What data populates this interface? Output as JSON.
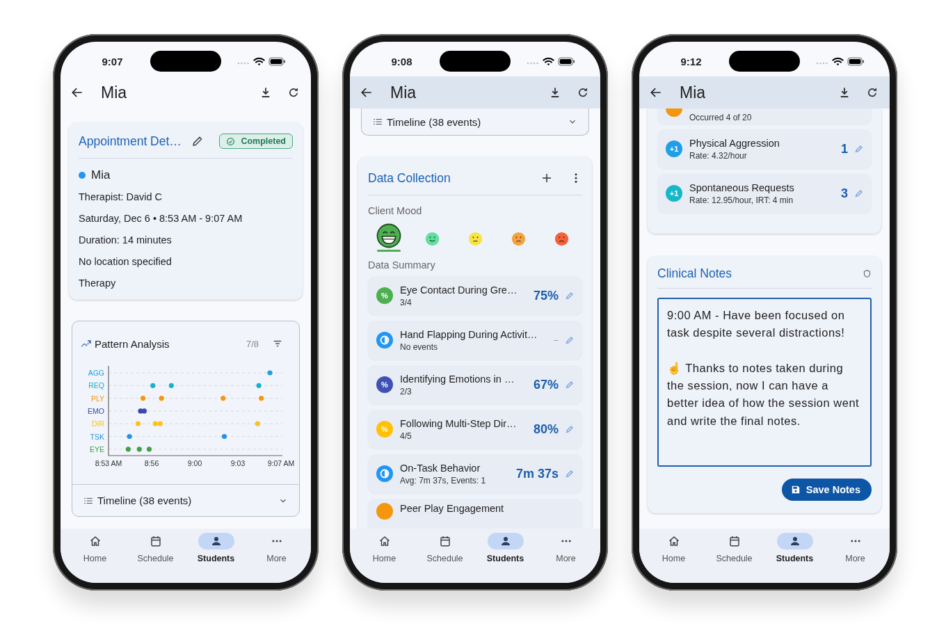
{
  "phones": [
    {
      "kind": "appointment",
      "status_bar": {
        "time": "9:07"
      },
      "app_bar": {
        "title": "Mia",
        "elevated": false
      },
      "appointment": {
        "title": "Appointment Det…",
        "status": "Completed",
        "client": "Mia",
        "details": [
          "Therapist: David C",
          "Saturday, Dec 6 • 8:53 AM - 9:07 AM",
          "Duration: 14 minutes",
          "No location specified",
          "Therapy"
        ]
      },
      "pattern": {
        "title": "Pattern Analysis",
        "count": "7/8",
        "rows": [
          {
            "label": "AGG",
            "color": "#1e9fe0"
          },
          {
            "label": "REQ",
            "color": "#16b3c8"
          },
          {
            "label": "PLY",
            "color": "#f5960f"
          },
          {
            "label": "EMO",
            "color": "#3949ab"
          },
          {
            "label": "DIR",
            "color": "#f9c31f"
          },
          {
            "label": "TSK",
            "color": "#2191ee"
          },
          {
            "label": "EYE",
            "color": "#43a047"
          }
        ],
        "time_labels": [
          "8:53 AM",
          "8:56",
          "9:00",
          "9:03",
          "9:07 AM"
        ]
      },
      "timeline": {
        "label": "Timeline (38 events)",
        "expanded": false
      },
      "nav": [
        {
          "label": "Home",
          "selected": false
        },
        {
          "label": "Schedule",
          "selected": false
        },
        {
          "label": "Students",
          "selected": true
        },
        {
          "label": "More",
          "selected": false
        }
      ]
    },
    {
      "kind": "data",
      "status_bar": {
        "time": "9:08"
      },
      "app_bar": {
        "title": "Mia",
        "elevated": true
      },
      "timeline": {
        "label": "Timeline (38 events)",
        "expanded": false
      },
      "data_collection": {
        "title": "Data Collection",
        "mood_label": "Client Mood",
        "moods": [
          {
            "kind": "grin",
            "color": "#4caf50",
            "selected": true
          },
          {
            "kind": "smile",
            "color": "#5ee0a0",
            "selected": false
          },
          {
            "kind": "neutral",
            "color": "#f7e443",
            "selected": false
          },
          {
            "kind": "uneasy",
            "color": "#f6a23c",
            "selected": false
          },
          {
            "kind": "sad",
            "color": "#f4603a",
            "selected": false
          }
        ],
        "summary_label": "Data Summary",
        "items": [
          {
            "kind": "percent",
            "badge": "%",
            "color": "#4caf50",
            "title": "Eye Contact During Gre…",
            "subtitle": "3/4",
            "value": "75%",
            "muted": false
          },
          {
            "kind": "timer",
            "color": "#2196f3",
            "title": "Hand Flapping During Activit…",
            "subtitle": "No events",
            "value": "–",
            "muted": true
          },
          {
            "kind": "percent",
            "badge": "%",
            "color": "#3f51b5",
            "title": "Identifying Emotions in …",
            "subtitle": "2/3",
            "value": "67%",
            "muted": false
          },
          {
            "kind": "percent",
            "badge": "%",
            "color": "#ffc107",
            "title": "Following Multi-Step Dir…",
            "subtitle": "4/5",
            "value": "80%",
            "muted": false
          },
          {
            "kind": "timer",
            "color": "#2196f3",
            "title": "On-Task Behavior",
            "subtitle": "Avg: 7m 37s, Events: 1",
            "value": "7m 37s",
            "muted": false
          },
          {
            "kind": "clipped",
            "color": "#f5960f",
            "title": "Peer Play Engagement"
          }
        ]
      },
      "nav": [
        {
          "label": "Home",
          "selected": false
        },
        {
          "label": "Schedule",
          "selected": false
        },
        {
          "label": "Students",
          "selected": true
        },
        {
          "label": "More",
          "selected": false
        }
      ]
    },
    {
      "kind": "notes",
      "status_bar": {
        "time": "9:12"
      },
      "app_bar": {
        "title": "Mia",
        "elevated": true
      },
      "behaviors": [
        {
          "kind": "clipped-top",
          "color": "#f5960f",
          "subtitle": "Occurred 4 of 20"
        },
        {
          "kind": "count",
          "badge": "+1",
          "color": "#1e9fe8",
          "title": "Physical Aggression",
          "subtitle": "Rate: 4.32/hour",
          "value": "1",
          "muted": false
        },
        {
          "kind": "count",
          "badge": "+1",
          "color": "#16b8c8",
          "title": "Spontaneous Requests",
          "subtitle": "Rate: 12.95/hour, IRT: 4 min",
          "value": "3",
          "muted": false
        }
      ],
      "notes": {
        "title": "Clinical Notes",
        "text": "9:00 AM - Have been focused on task despite several distractions!\n\n☝ Thanks to notes taken during the session, now I can have a better idea of how the session went and write the final notes.",
        "button": "Save Notes"
      },
      "nav": [
        {
          "label": "Home",
          "selected": false
        },
        {
          "label": "Schedule",
          "selected": false
        },
        {
          "label": "Students",
          "selected": true
        },
        {
          "label": "More",
          "selected": false
        }
      ]
    }
  ]
}
